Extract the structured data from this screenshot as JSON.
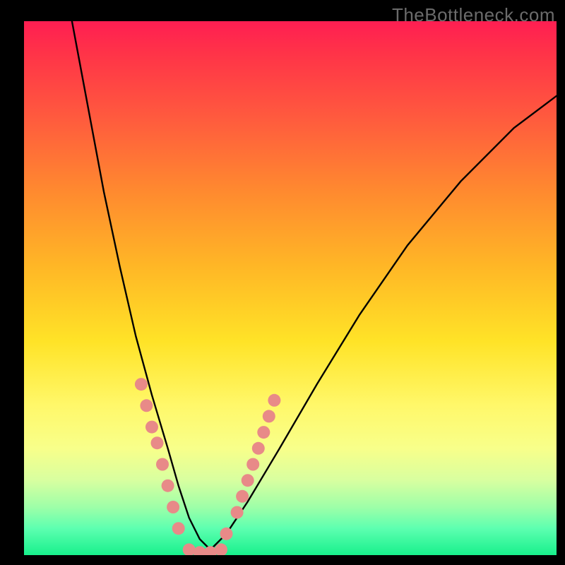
{
  "watermark": "TheBottleneck.com",
  "chart_data": {
    "type": "line",
    "title": "",
    "xlabel": "",
    "ylabel": "",
    "xlim": [
      0,
      100
    ],
    "ylim": [
      0,
      100
    ],
    "curve": {
      "description": "V-shaped bottleneck curve, steep on the left, shallower on the right",
      "x": [
        9,
        12,
        15,
        18,
        21,
        24,
        27,
        29,
        31,
        33,
        35,
        38,
        42,
        48,
        55,
        63,
        72,
        82,
        92,
        100
      ],
      "y": [
        100,
        84,
        68,
        54,
        41,
        30,
        20,
        13,
        7,
        3,
        1,
        4,
        10,
        20,
        32,
        45,
        58,
        70,
        80,
        86
      ]
    },
    "marker_clusters": [
      {
        "description": "left descending branch dots",
        "points": [
          {
            "x": 22,
            "y": 32
          },
          {
            "x": 23,
            "y": 28
          },
          {
            "x": 24,
            "y": 24
          },
          {
            "x": 25,
            "y": 21
          },
          {
            "x": 26,
            "y": 17
          },
          {
            "x": 27,
            "y": 13
          },
          {
            "x": 28,
            "y": 9
          },
          {
            "x": 29,
            "y": 5
          }
        ]
      },
      {
        "description": "valley bottom dots",
        "points": [
          {
            "x": 31,
            "y": 1
          },
          {
            "x": 33,
            "y": 0.5
          },
          {
            "x": 35,
            "y": 0.5
          },
          {
            "x": 37,
            "y": 1
          }
        ]
      },
      {
        "description": "right ascending branch dots",
        "points": [
          {
            "x": 38,
            "y": 4
          },
          {
            "x": 40,
            "y": 8
          },
          {
            "x": 41,
            "y": 11
          },
          {
            "x": 42,
            "y": 14
          },
          {
            "x": 43,
            "y": 17
          },
          {
            "x": 44,
            "y": 20
          },
          {
            "x": 45,
            "y": 23
          },
          {
            "x": 46,
            "y": 26
          },
          {
            "x": 47,
            "y": 29
          }
        ]
      }
    ],
    "marker_color": "#e88a88",
    "curve_color": "#000000"
  }
}
